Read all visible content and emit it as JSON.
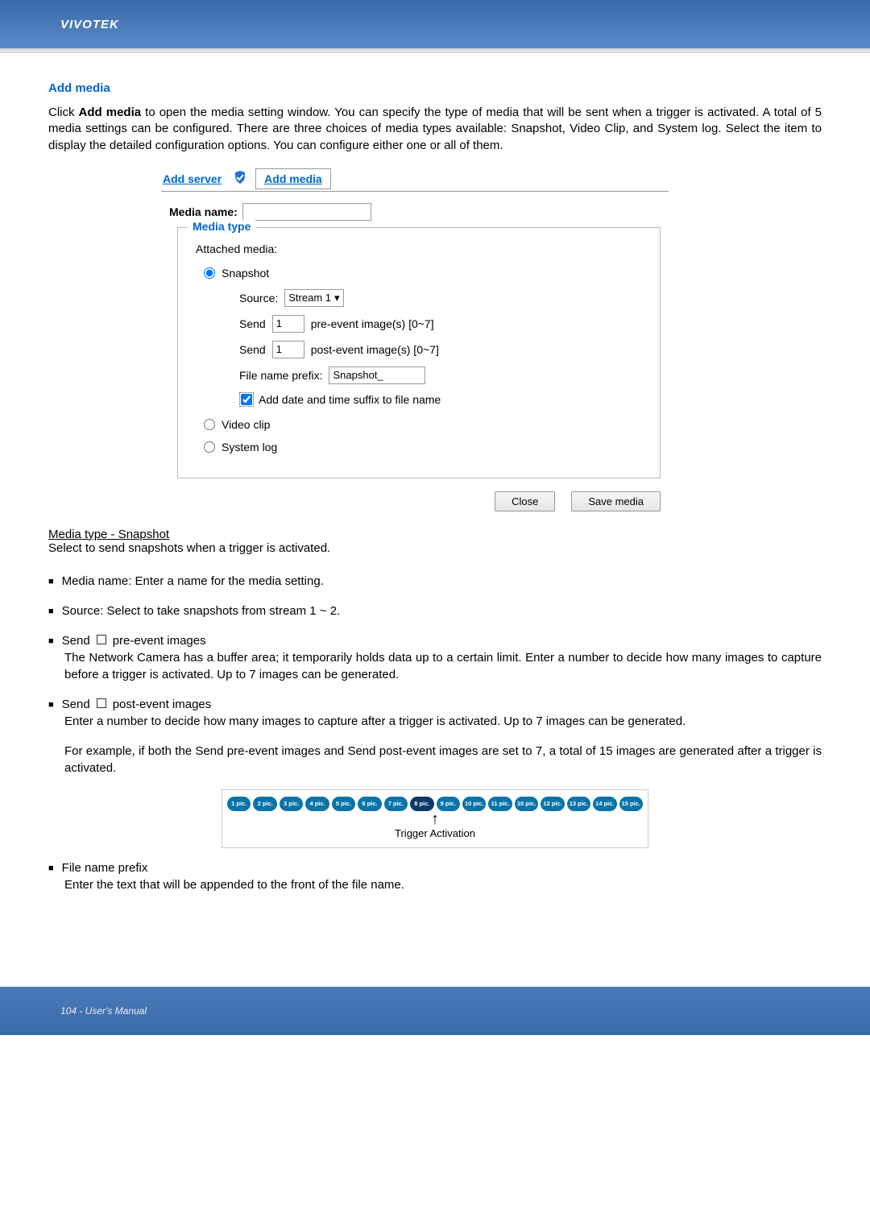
{
  "header": {
    "brand": "VIVOTEK"
  },
  "section_title": "Add media",
  "intro": "Click Add media to open the media setting window. You can specify the type of media that will be sent when a trigger is activated. A total of 5 media settings can be configured. There are three choices of media types available: Snapshot, Video Clip, and System log. Select the item to display the detailed configuration options. You can configure either one or all of them.",
  "dialog": {
    "tabs": {
      "add_server": "Add server",
      "add_media": "Add media"
    },
    "media_name_label": "Media name:",
    "media_name_value": "",
    "fieldset_title": "Media type",
    "attached_label": "Attached media:",
    "radios": {
      "snapshot": "Snapshot",
      "video_clip": "Video clip",
      "system_log": "System log"
    },
    "snapshot": {
      "source_label": "Source:",
      "source_value": "Stream 1",
      "send_label": "Send",
      "pre_value": "1",
      "pre_suffix": "pre-event image(s) [0~7]",
      "post_value": "1",
      "post_suffix": "post-event image(s) [0~7]",
      "prefix_label": "File name prefix:",
      "prefix_value": "Snapshot_",
      "suffix_checkbox": "Add date and time suffix to file name"
    },
    "buttons": {
      "close": "Close",
      "save": "Save media"
    }
  },
  "subheading": "Media type - Snapshot",
  "sub_para": "Select to send snapshots when a trigger is activated.",
  "bullets": {
    "media_name": "Media name: Enter a name for the media setting.",
    "source": "Source: Select to take snapshots from stream 1 ~ 2.",
    "pre_head": "Send",
    "pre_tail": "pre-event images",
    "pre_body": "The Network Camera has a buffer area; it temporarily holds data up to a certain limit. Enter a number to decide how many images to capture before a trigger is activated. Up to 7 images can be generated.",
    "post_head": "Send",
    "post_tail": "post-event images",
    "post_body": "Enter a number to decide how many images to capture after a trigger is activated. Up to 7 images can be generated.",
    "example": "For example, if both the Send pre-event images and Send post-event images are set to 7, a total of 15 images are generated after a trigger is activated.",
    "file_prefix_head": "File name prefix",
    "file_prefix_body": "Enter the text that will be appended to the front of the file name."
  },
  "chart_data": {
    "type": "table",
    "title": "Trigger Activation",
    "pics": [
      "1 pic.",
      "2 pic.",
      "3 pic.",
      "4 pic.",
      "5 pic.",
      "6 pic.",
      "7 pic.",
      "8 pic.",
      "9 pic.",
      "10 pic.",
      "11 pic.",
      "10 pic.",
      "12 pic.",
      "13 pic.",
      "14 pic.",
      "15 pic."
    ],
    "highlight_index": 7
  },
  "footer": {
    "text": "104 - User's Manual"
  }
}
